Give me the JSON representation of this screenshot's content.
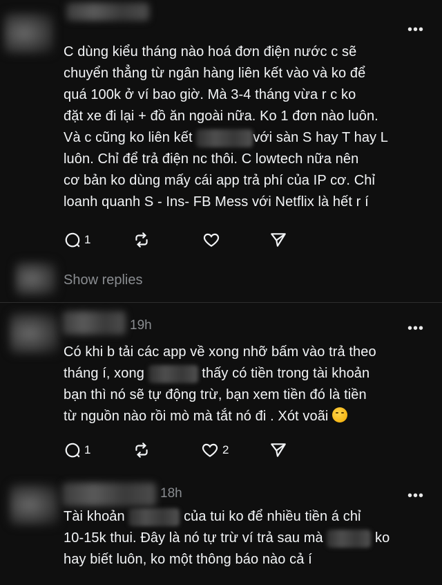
{
  "comments": [
    {
      "time": "",
      "lines": [
        "C dùng kiểu tháng nào hoá đơn điện nước c sẽ",
        "chuyển thẳng từ ngân hàng liên kết vào và ko để",
        "quá 100k ở ví bao giờ. Mà 3-4 tháng vừa r c ko",
        "đặt xe đi lại + đồ ăn ngoài nữa. Ko 1 đơn nào luôn.",
        [
          "Và c cũng ko liên kết",
          "với sàn S hay T hay L"
        ],
        "luôn. Chỉ để trả điện nc thôi. C lowtech nữa nên",
        "cơ bản ko dùng mấy cái app trả phí của IP cơ. Chỉ",
        "loanh quanh S - Ins- FB Mess với Netflix là hết r í"
      ],
      "reply_count": "1",
      "like_count": ""
    },
    {
      "time": "19h",
      "lines": [
        "Có khi b tải các app về xong nhỡ bấm vào trả theo",
        [
          "tháng í, xong",
          "thấy có tiền trong tài khoản"
        ],
        "bạn thì nó sẽ tự động trừ, bạn xem tiền đó là tiền",
        "từ nguồn nào rồi mò mà tắt nó đi . Xót voãi"
      ],
      "reply_count": "1",
      "like_count": "2"
    },
    {
      "time": "18h",
      "lines": [
        [
          "Tài khoản",
          "của tui ko để nhiều tiền á chỉ"
        ],
        [
          "10-15k thui. Đây là nó tự trừ ví trả sau mà",
          "ko"
        ],
        "hay biết luôn, ko một thông báo nào cả í"
      ]
    }
  ],
  "show_replies": "Show replies",
  "more_glyph": "•••",
  "icons": {
    "reply": "comment-bubble-icon",
    "repost": "repost-arrows-icon",
    "like": "heart-icon",
    "share": "send-icon",
    "reaction": "woozy-face-emoji"
  }
}
